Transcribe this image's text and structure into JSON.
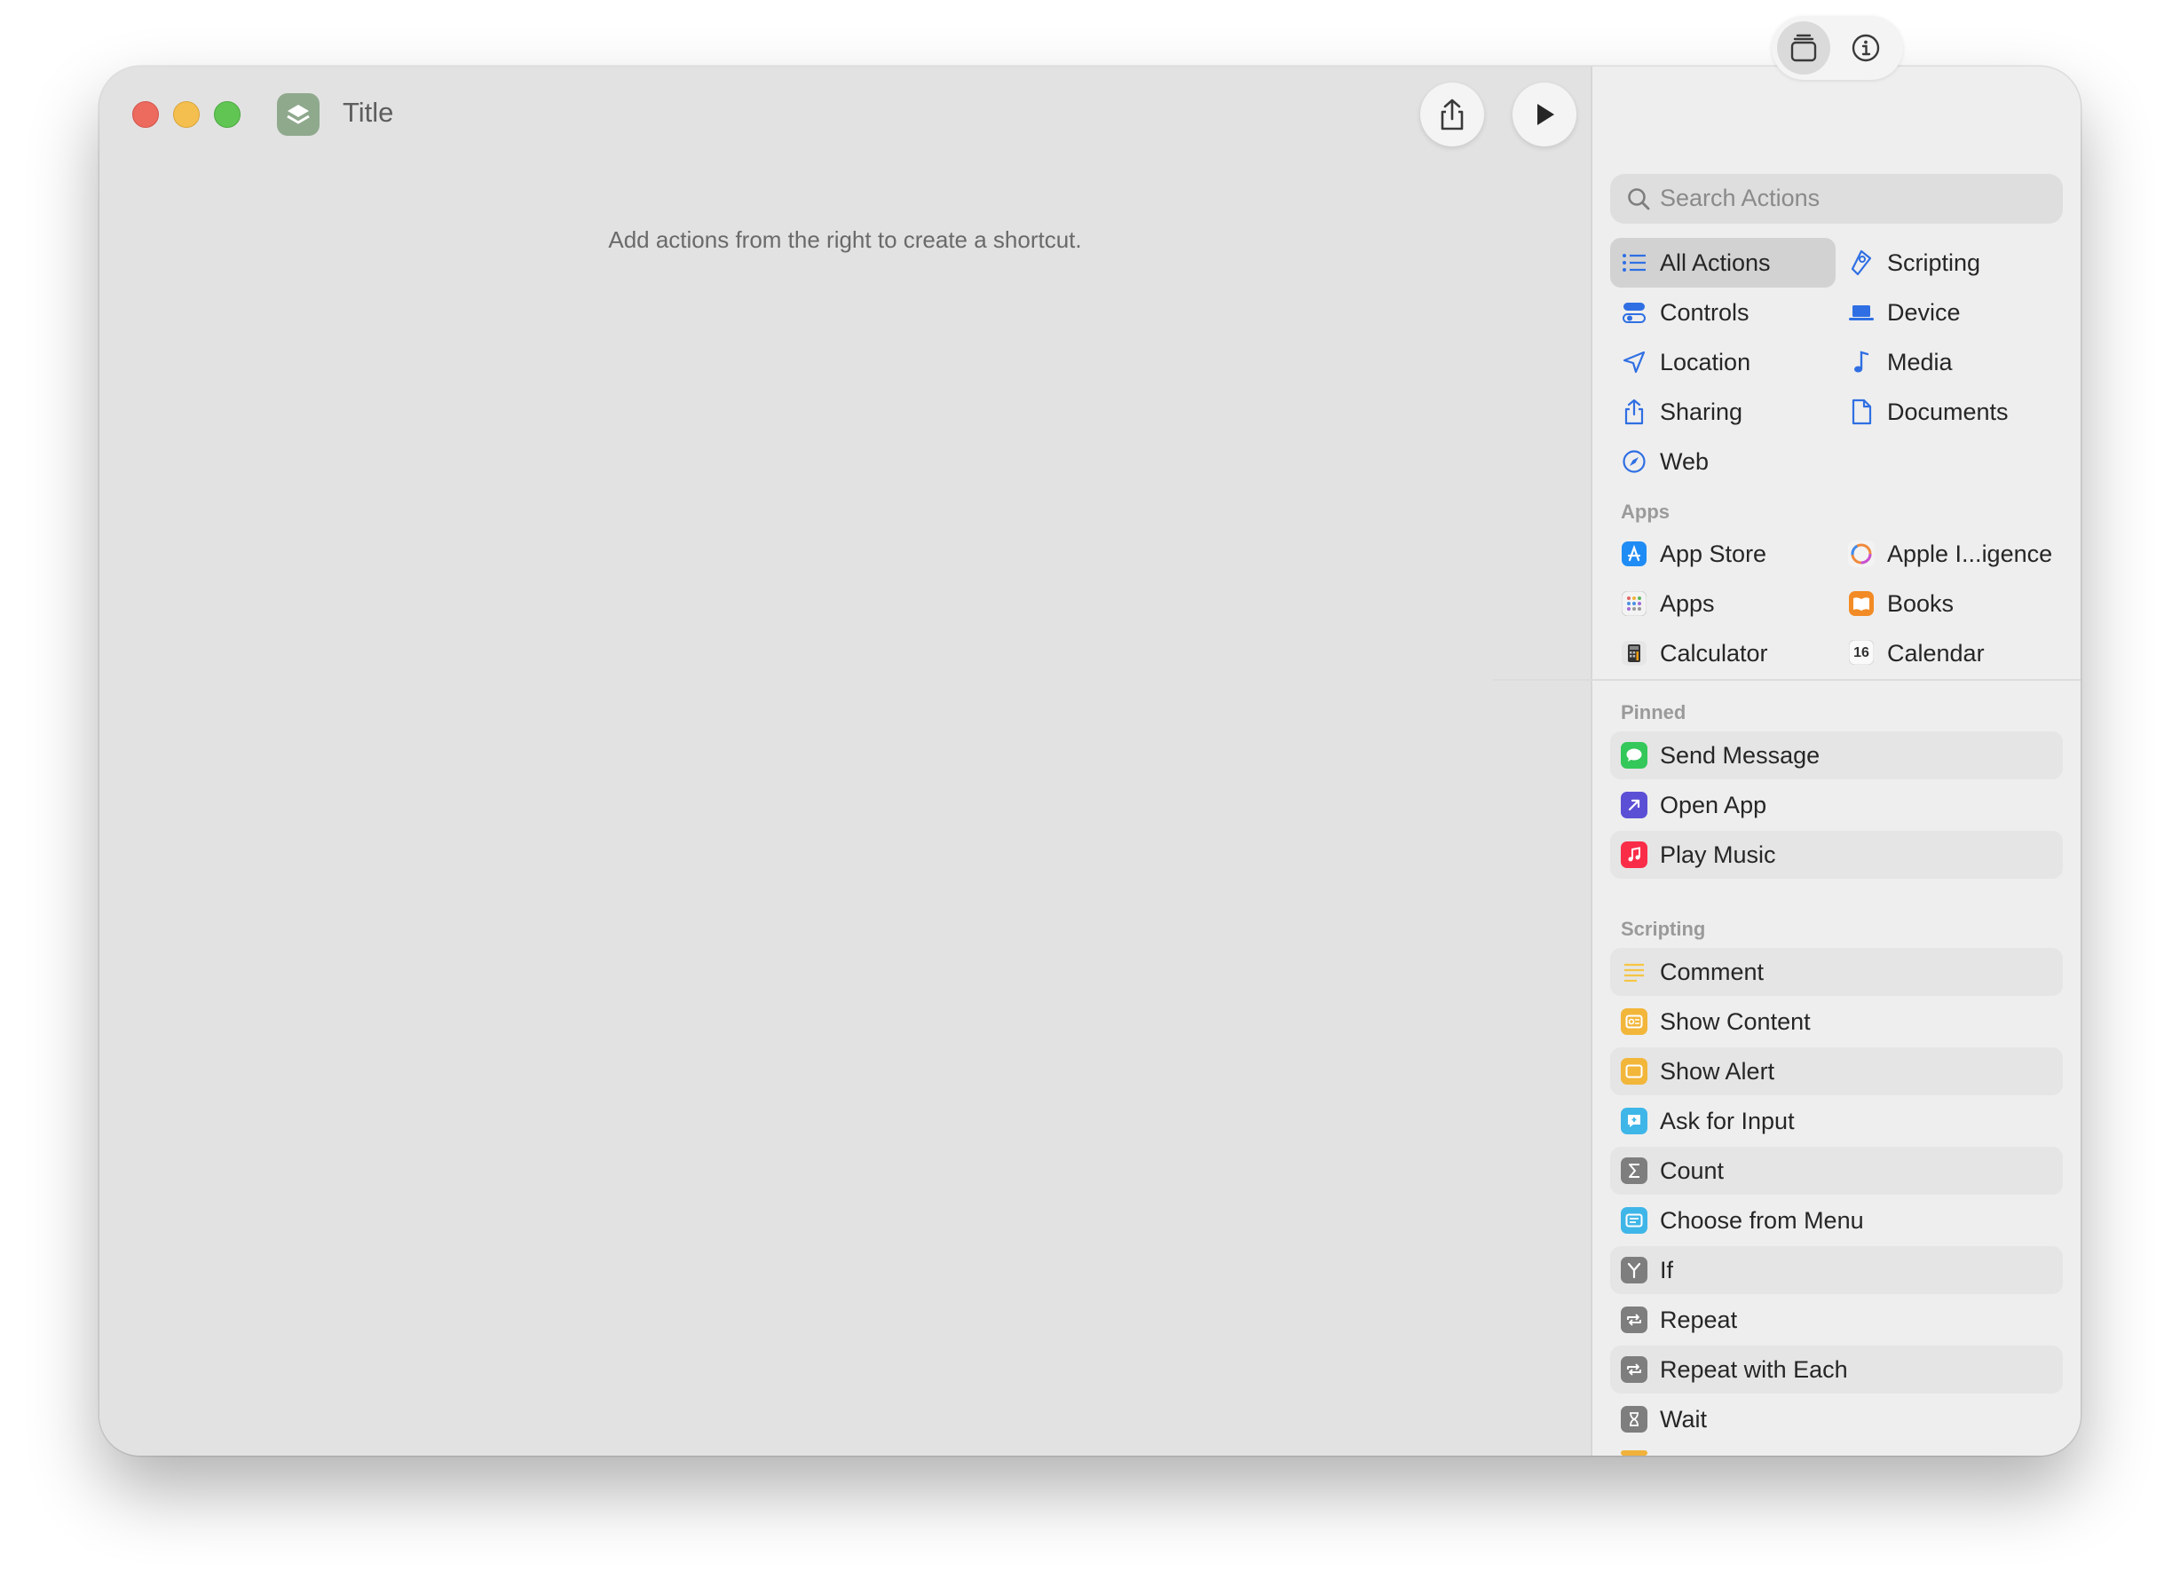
{
  "window": {
    "title": "Title"
  },
  "editor": {
    "hint": "Add actions from the right to create a shortcut."
  },
  "toolbar": {
    "share_icon": "share-icon",
    "run_icon": "play-icon"
  },
  "sidebar": {
    "segments": [
      {
        "icon": "library-icon",
        "selected": true
      },
      {
        "icon": "info-icon",
        "selected": false
      }
    ],
    "search": {
      "placeholder": "Search Actions"
    },
    "categories": [
      {
        "label": "All Actions",
        "icon": "list-icon",
        "selected": true
      },
      {
        "label": "Scripting",
        "icon": "scripting-icon"
      },
      {
        "label": "Controls",
        "icon": "controls-icon"
      },
      {
        "label": "Device",
        "icon": "laptop-icon"
      },
      {
        "label": "Location",
        "icon": "location-arrow-icon"
      },
      {
        "label": "Media",
        "icon": "music-note-icon"
      },
      {
        "label": "Sharing",
        "icon": "share-icon"
      },
      {
        "label": "Documents",
        "icon": "document-icon"
      },
      {
        "label": "Web",
        "icon": "compass-icon"
      }
    ],
    "apps_heading": "Apps",
    "apps": [
      {
        "label": "App Store",
        "icon": "app-store-icon"
      },
      {
        "label": "Apple I...igence",
        "icon": "apple-intelligence-icon"
      },
      {
        "label": "Apps",
        "icon": "apps-grid-icon"
      },
      {
        "label": "Books",
        "icon": "books-icon"
      },
      {
        "label": "Calculator",
        "icon": "calculator-icon"
      },
      {
        "label": "Calendar",
        "icon": "calendar-icon",
        "badge": "16"
      }
    ],
    "pinned_heading": "Pinned",
    "pinned": [
      {
        "label": "Send Message",
        "icon": "messages-icon",
        "color": "#34c759"
      },
      {
        "label": "Open App",
        "icon": "open-app-icon",
        "color": "#5b4fd6"
      },
      {
        "label": "Play Music",
        "icon": "music-icon",
        "color": "#fa2d48"
      }
    ],
    "scripting_heading": "Scripting",
    "scripting": [
      {
        "label": "Comment",
        "icon": "comment-icon",
        "color": "#f6c543"
      },
      {
        "label": "Show Content",
        "icon": "show-content-icon",
        "color": "#f2b63a"
      },
      {
        "label": "Show Alert",
        "icon": "show-alert-icon",
        "color": "#f2b63a"
      },
      {
        "label": "Ask for Input",
        "icon": "ask-input-icon",
        "color": "#3fb6e8"
      },
      {
        "label": "Count",
        "icon": "sigma-icon",
        "color": "#7e7e7e"
      },
      {
        "label": "Choose from Menu",
        "icon": "menu-icon",
        "color": "#3fb6e8"
      },
      {
        "label": "If",
        "icon": "branch-icon",
        "color": "#7e7e7e"
      },
      {
        "label": "Repeat",
        "icon": "repeat-icon",
        "color": "#7e7e7e"
      },
      {
        "label": "Repeat with Each",
        "icon": "repeat-icon",
        "color": "#7e7e7e"
      },
      {
        "label": "Wait",
        "icon": "hourglass-icon",
        "color": "#7e7e7e"
      }
    ]
  }
}
